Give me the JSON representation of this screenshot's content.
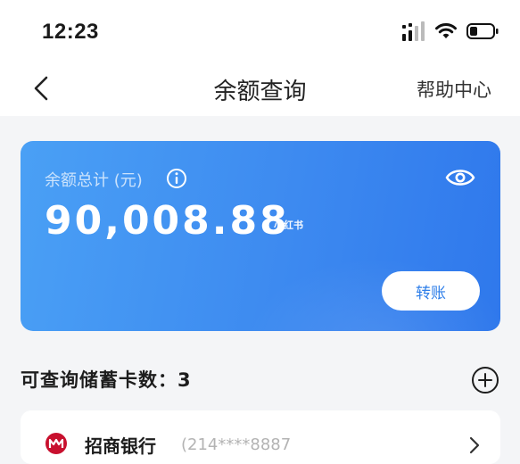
{
  "status_bar": {
    "time": "12:23"
  },
  "nav": {
    "title": "余额查询",
    "help": "帮助中心"
  },
  "balance_card": {
    "label": "余额总计 (元)",
    "amount": "90,008.88",
    "watermark": "小红书",
    "transfer_button": "转账"
  },
  "cards_section": {
    "title": "可查询储蓄卡数：3"
  },
  "bank_card": {
    "name": "招商银行",
    "number": "(214****8887"
  },
  "colors": {
    "card_gradient_start": "#4aa0f5",
    "card_gradient_end": "#2f78ec",
    "accent": "#2f7fe9",
    "bank_logo": "#c8102e"
  }
}
